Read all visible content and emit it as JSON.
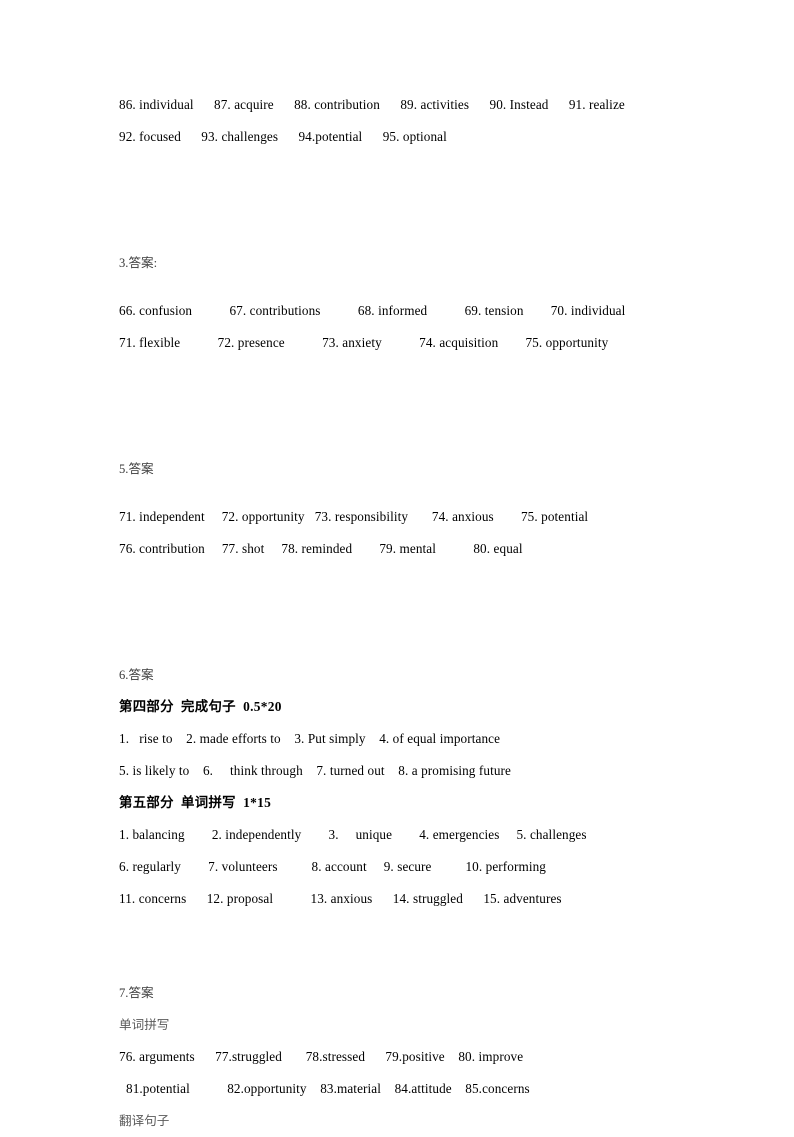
{
  "document": {
    "background_color": "#ffffff",
    "text_color": "#000000",
    "muted_text_color": "#5a5a5a"
  },
  "sections": {
    "top_answers": {
      "line1": "86. individual      87. acquire      88. contribution      89. activities      90. Instead      91. realize",
      "line2": "92. focused      93. challenges      94.potential      95. optional"
    },
    "section3": {
      "heading": "3.答案:",
      "line1": "66. confusion           67. contributions           68. informed           69. tension        70. individual",
      "line2": "71. flexible           72. presence           73. anxiety           74. acquisition        75. opportunity"
    },
    "section5": {
      "heading": "5.答案",
      "line1": "71. independent     72. opportunity   73. responsibility       74. anxious        75. potential",
      "line2": "76. contribution     77. shot     78. reminded        79. mental           80. equal"
    },
    "section6": {
      "heading": "6.答案",
      "part4_heading": "第四部分  完成句子  0.5*20",
      "part4_line1": "1.   rise to    2. made efforts to    3. Put simply    4. of equal importance",
      "part4_line2": "5. is likely to    6.     think through    7. turned out    8. a promising future",
      "part5_heading": "第五部分  单词拼写  1*15",
      "part5_line1": "1. balancing        2. independently        3.     unique        4. emergencies     5. challenges",
      "part5_line2": "6. regularly        7. volunteers          8. account     9. secure          10. performing",
      "part5_line3": "11. concerns      12. proposal           13. anxious      14. struggled      15. adventures"
    },
    "section7": {
      "heading": "7.答案",
      "sub_heading_spelling": "单词拼写",
      "line1": "76. arguments      77.struggled       78.stressed      79.positive    80. improve",
      "line2": "81.potential           82.opportunity    83.material    84.attitude    85.concerns",
      "sub_heading_translation": "翻译句子"
    }
  }
}
